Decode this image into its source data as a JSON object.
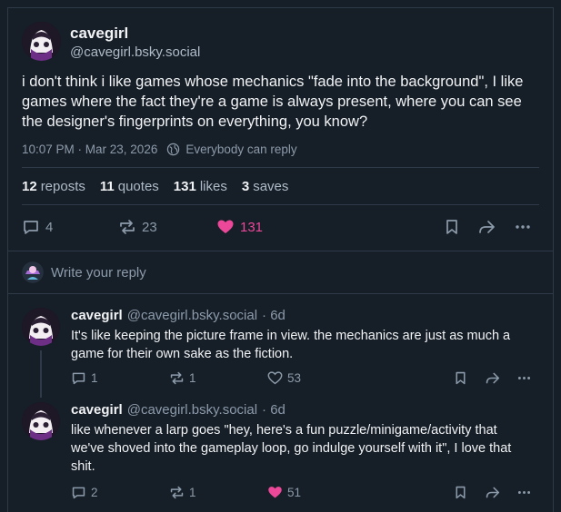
{
  "post": {
    "author_name": "cavegirl",
    "author_handle": "@cavegirl.bsky.social",
    "text": "i don't think i like games whose mechanics \"fade into the background\", I like games where the fact they're a game is always present, where you can see the designer's fingerprints on everything, you know?",
    "timestamp": "10:07 PM · Mar 23, 2026",
    "reply_setting": "Everybody can reply",
    "stats": {
      "reposts_count": "12",
      "reposts_label": "reposts",
      "quotes_count": "11",
      "quotes_label": "quotes",
      "likes_count": "131",
      "likes_label": "likes",
      "saves_count": "3",
      "saves_label": "saves"
    },
    "actions": {
      "replies": "4",
      "reposts": "23",
      "likes": "131"
    }
  },
  "reply_prompt": "Write your reply",
  "replies": [
    {
      "author_name": "cavegirl",
      "author_handle": "@cavegirl.bsky.social",
      "age": "· 6d",
      "text": "It's like keeping the picture frame in view. the mechanics are just as much a game for their own sake as the fiction.",
      "replies": "1",
      "reposts": "1",
      "likes": "53",
      "liked": false
    },
    {
      "author_name": "cavegirl",
      "author_handle": "@cavegirl.bsky.social",
      "age": "· 6d",
      "text": "like whenever a larp goes \"hey, here's a fun puzzle/minigame/activity that we've shoved into the gameplay loop, go indulge yourself with it\", I love that shit.",
      "replies": "2",
      "reposts": "1",
      "likes": "51",
      "liked": true
    }
  ],
  "colors": {
    "background": "#161e27",
    "like": "#ec4899",
    "muted": "#8c9bab",
    "border": "#2e3a48"
  }
}
